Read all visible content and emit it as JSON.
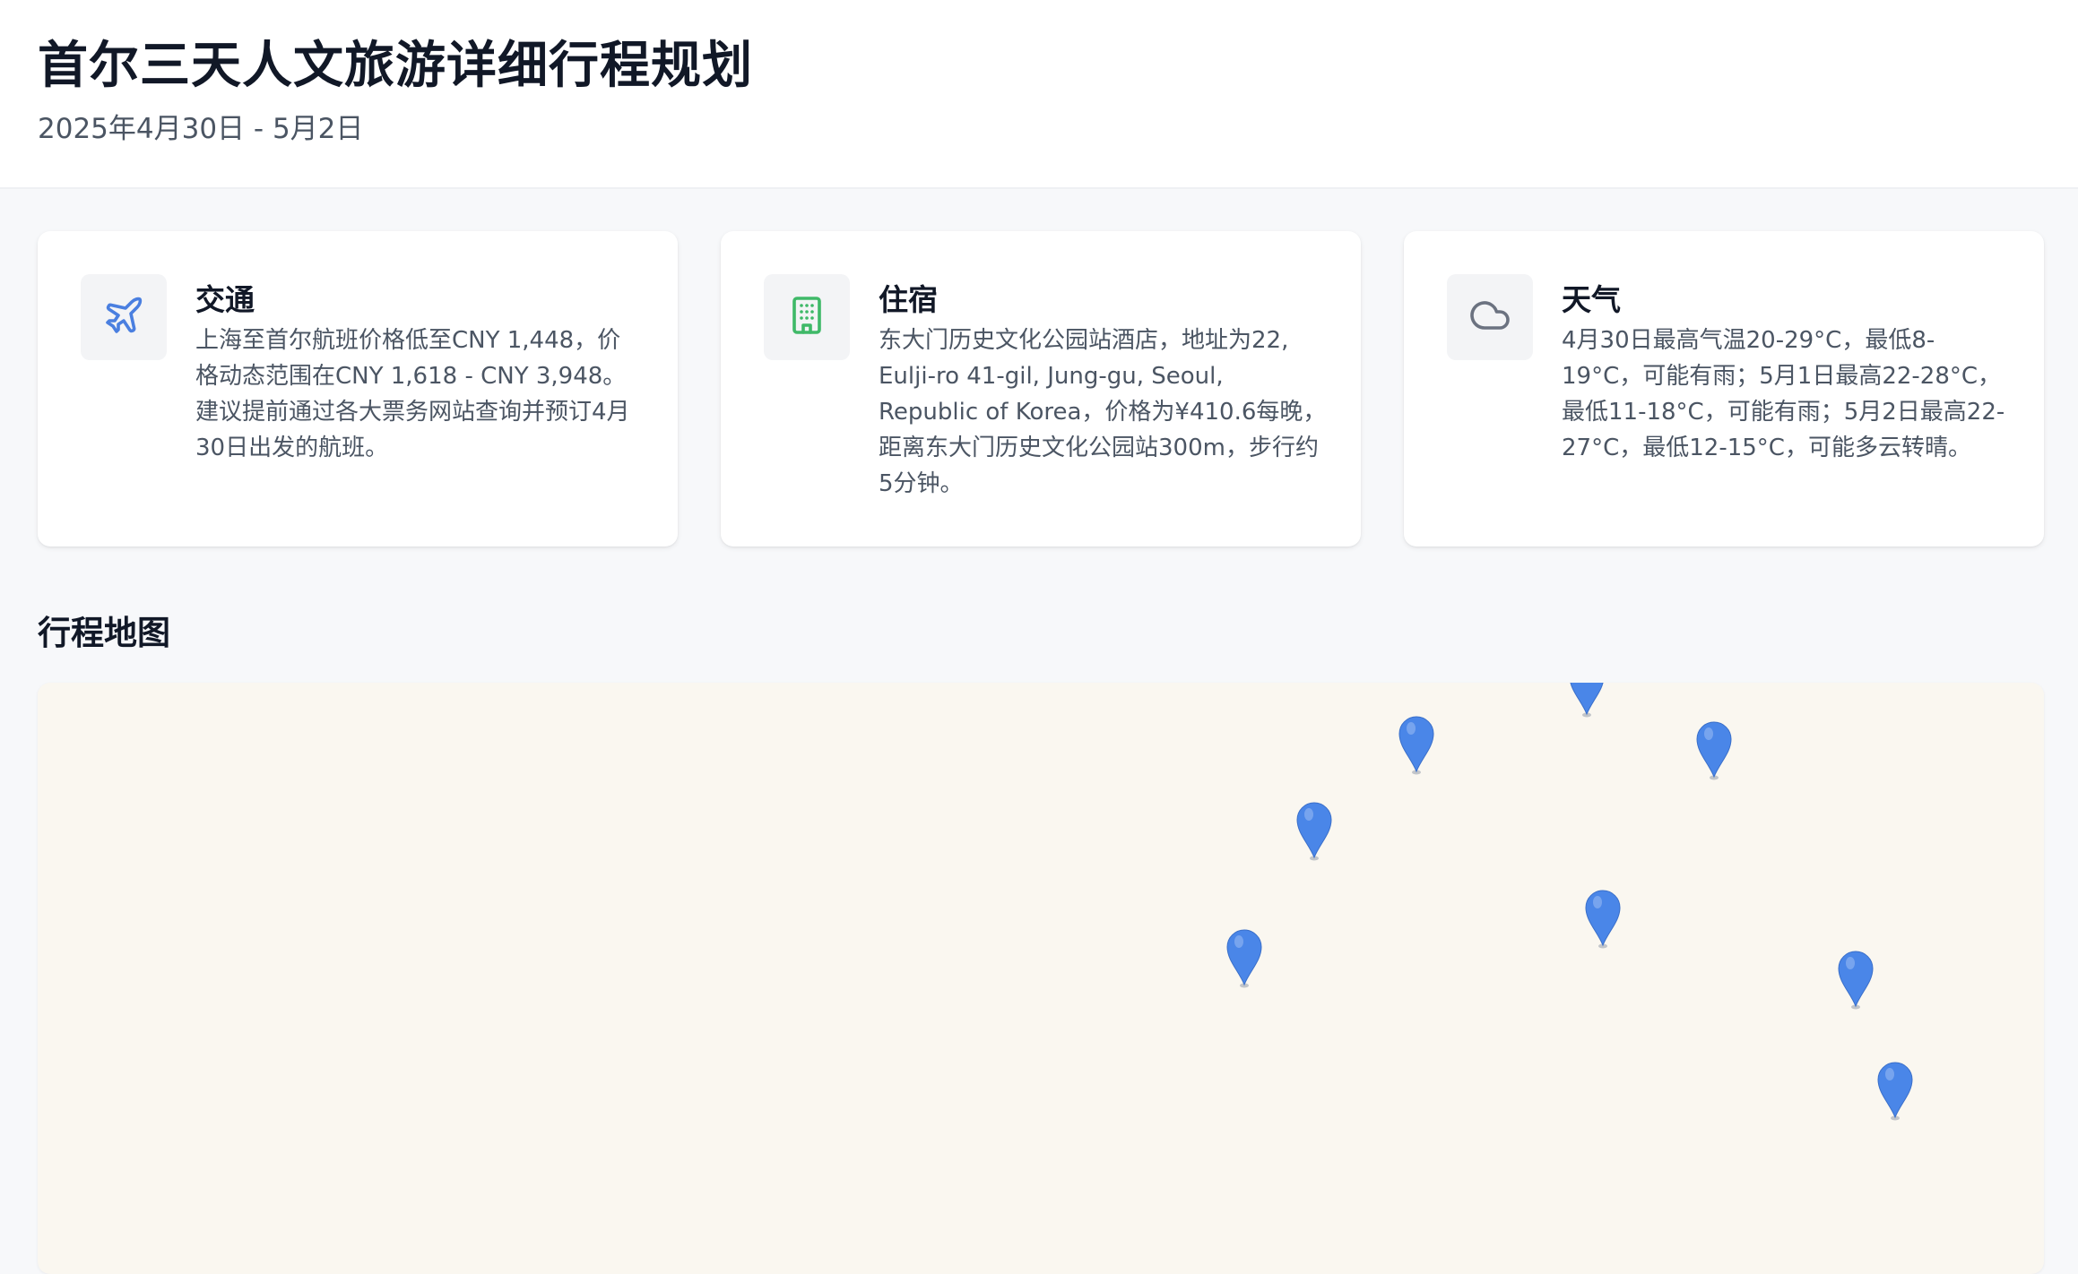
{
  "header": {
    "title": "首尔三天人文旅游详细行程规划",
    "subtitle": "2025年4月30日 - 5月2日"
  },
  "cards": {
    "transport": {
      "title": "交通",
      "text": "上海至首尔航班价格低至CNY 1,448，价格动态范围在CNY 1,618 - CNY 3,948。建议提前通过各大票务网站查询并预订4月30日出发的航班。",
      "icon": "airplane-icon",
      "icon_color": "#4a7fe0"
    },
    "lodging": {
      "title": "住宿",
      "text": "东大门历史文化公园站酒店，地址为22, Eulji-ro 41-gil, Jung-gu, Seoul, Republic of Korea，价格为¥410.6每晚，距离东大门历史文化公园站300m，步行约5分钟。",
      "icon": "building-icon",
      "icon_color": "#3fb968"
    },
    "weather": {
      "title": "天气",
      "text": "4月30日最高气温20-29°C，最低8-19°C，可能有雨；5月1日最高22-28°C，最低11-18°C，可能有雨；5月2日最高22-27°C，最低12-15°C，可能多云转晴。",
      "icon": "cloud-icon",
      "icon_color": "#6b7280"
    }
  },
  "map_section": {
    "title": "行程地图",
    "pin_icon": "map-pin-icon",
    "pin_color": "#4a86e8",
    "background": "#faf7f0",
    "pin_count": 9
  }
}
